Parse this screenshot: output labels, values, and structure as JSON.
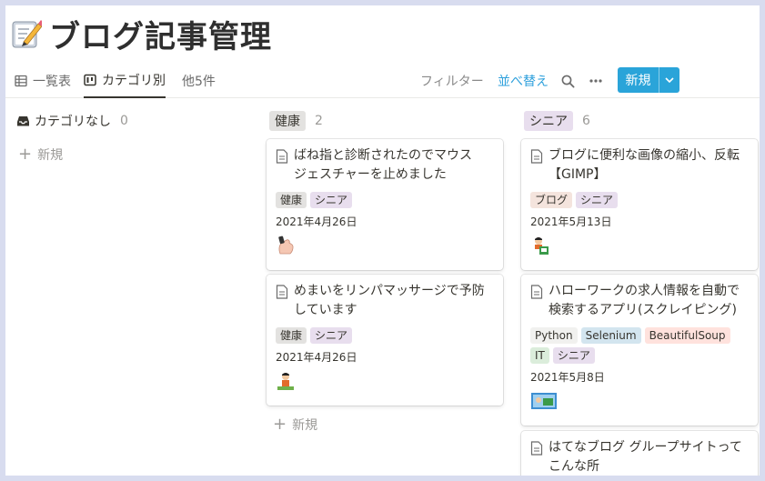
{
  "page": {
    "title": "ブログ記事管理",
    "icon": "memo-pencil-icon"
  },
  "views": {
    "tabs": [
      {
        "label": "一覧表",
        "icon": "table-icon"
      },
      {
        "label": "カテゴリ別",
        "icon": "board-icon"
      }
    ],
    "more": "他5件"
  },
  "toolbar": {
    "filter": "フィルター",
    "sort": "並べ替え",
    "search_icon": "search-icon",
    "more_icon": "more-dots-icon",
    "new_label": "新規",
    "new_dropdown_icon": "chevron-down-icon"
  },
  "colors": {
    "accent": "#2aa4d9",
    "tag_health_bg": "#e3e2e0",
    "tag_senior_bg": "#e8deee",
    "tag_blog_bg": "#f4e4dd",
    "tag_selenium_bg": "#d3e5ef",
    "tag_soup_bg": "#ffe2dd",
    "tag_it_bg": "#dbeddb",
    "tag_python_bg": "#f1f1ef"
  },
  "board": {
    "add_new_label": "新規",
    "columns": [
      {
        "name": "カテゴリなし",
        "count": "0",
        "icon": "inbox-icon",
        "cards": []
      },
      {
        "name": "健康",
        "count": "2",
        "cards": [
          {
            "title_lines": [
              "ばね指と診断されたのでマウス",
              "ジェスチャーを止めました"
            ],
            "tags": [
              "健康",
              "シニア"
            ],
            "date": "2021年4月26日",
            "avatar": "hand-avatar"
          },
          {
            "title_lines": [
              "めまいをリンパマッサージで予防",
              "しています"
            ],
            "tags": [
              "健康",
              "シニア"
            ],
            "date": "2021年4月26日",
            "avatar": "person-avatar"
          }
        ]
      },
      {
        "name": "シニア",
        "count": "6",
        "cards": [
          {
            "title_lines": [
              "ブログに便利な画像の縮小、反転",
              "【GIMP】"
            ],
            "tags": [
              "ブログ",
              "シニア"
            ],
            "date": "2021年5月13日",
            "avatar": "person-avatar"
          },
          {
            "title_lines": [
              "ハローワークの求人情報を自動で",
              "検索するアプリ(スクレイピング)"
            ],
            "tags": [
              "Python",
              "Selenium",
              "BeautifulSoup",
              "IT",
              "シニア"
            ],
            "date": "2021年5月8日",
            "avatar": "screen-avatar"
          },
          {
            "title_lines": [
              "はてなブログ グループサイトって",
              "こんな所"
            ],
            "tags": [],
            "date": "",
            "avatar": ""
          }
        ]
      }
    ]
  }
}
